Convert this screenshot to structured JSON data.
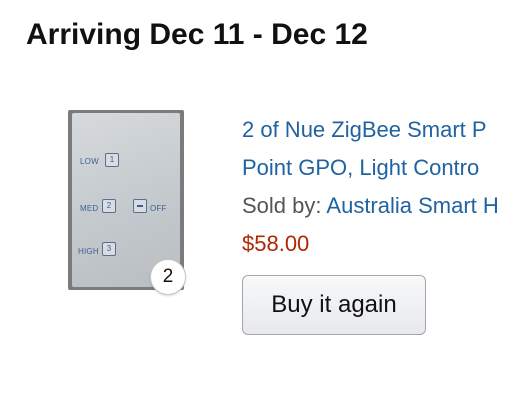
{
  "shipment": {
    "arrival_text": "Arriving Dec 11 - Dec 12"
  },
  "item": {
    "image_alt": "Nue ZigBee Smart Power Point switch plate",
    "quantity": "2",
    "title_line1": "2 of Nue ZigBee Smart P",
    "title_line2": "Point GPO, Light Contro",
    "sold_by_prefix": "Sold by:",
    "seller": "Australia Smart H",
    "price": "$58.00",
    "buy_again_label": "Buy it again",
    "switch_labels": {
      "low": "LOW",
      "low_key": "1",
      "med": "MED",
      "med_key": "2",
      "off": "OFF",
      "high": "HIGH",
      "high_key": "3"
    }
  },
  "colors": {
    "link": "#2162a1",
    "price": "#b12704",
    "muted": "#555555"
  }
}
